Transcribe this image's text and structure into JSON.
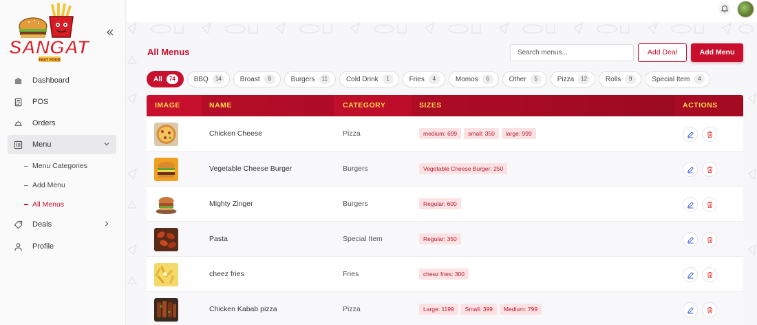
{
  "brand": {
    "name": "SANGAT",
    "tagline": "FAST FOOD"
  },
  "sidebar": {
    "items": [
      {
        "label": "Dashboard",
        "icon": "dashboard-icon"
      },
      {
        "label": "POS",
        "icon": "pos-icon"
      },
      {
        "label": "Orders",
        "icon": "orders-icon"
      },
      {
        "label": "Menu",
        "icon": "menu-icon"
      },
      {
        "label": "Deals",
        "icon": "deals-icon"
      },
      {
        "label": "Profile",
        "icon": "profile-icon"
      }
    ],
    "submenu": [
      {
        "label": "Menu Categories"
      },
      {
        "label": "Add Menu"
      },
      {
        "label": "All Menus"
      }
    ]
  },
  "page": {
    "title": "All Menus",
    "search_placeholder": "Search menus...",
    "add_deal_label": "Add Deal",
    "add_menu_label": "Add Menu"
  },
  "filters": [
    {
      "label": "All",
      "count": "74"
    },
    {
      "label": "BBQ",
      "count": "14"
    },
    {
      "label": "Broast",
      "count": "8"
    },
    {
      "label": "Burgers",
      "count": "11"
    },
    {
      "label": "Cold Drink",
      "count": "1"
    },
    {
      "label": "Fries",
      "count": "4"
    },
    {
      "label": "Momos",
      "count": "6"
    },
    {
      "label": "Other",
      "count": "5"
    },
    {
      "label": "Pizza",
      "count": "12"
    },
    {
      "label": "Rolls",
      "count": "9"
    },
    {
      "label": "Special Item",
      "count": "4"
    }
  ],
  "table": {
    "headers": {
      "image": "IMAGE",
      "name": "NAME",
      "category": "CATEGORY",
      "sizes": "SIZES",
      "actions": "ACTIONS"
    },
    "rows": [
      {
        "name": "Chicken Cheese",
        "category": "Pizza",
        "sizes": [
          "medium: 699",
          "small: 350",
          "large: 999"
        ]
      },
      {
        "name": "Vegetable Cheese Burger",
        "category": "Burgers",
        "sizes": [
          "Vegetable Cheese Burger: 250"
        ]
      },
      {
        "name": "Mighty Zinger",
        "category": "Burgers",
        "sizes": [
          "Regular: 600"
        ]
      },
      {
        "name": "Pasta",
        "category": "Special Item",
        "sizes": [
          "Regular: 350"
        ]
      },
      {
        "name": "cheez fries",
        "category": "Fries",
        "sizes": [
          "cheez fries: 300"
        ]
      },
      {
        "name": "Chicken Kabab pizza",
        "category": "Pizza",
        "sizes": [
          "Large: 1199",
          "Small: 399",
          "Medium: 799"
        ]
      }
    ]
  },
  "colors": {
    "accent": "#c8102e",
    "header_text": "#ffd84a"
  }
}
